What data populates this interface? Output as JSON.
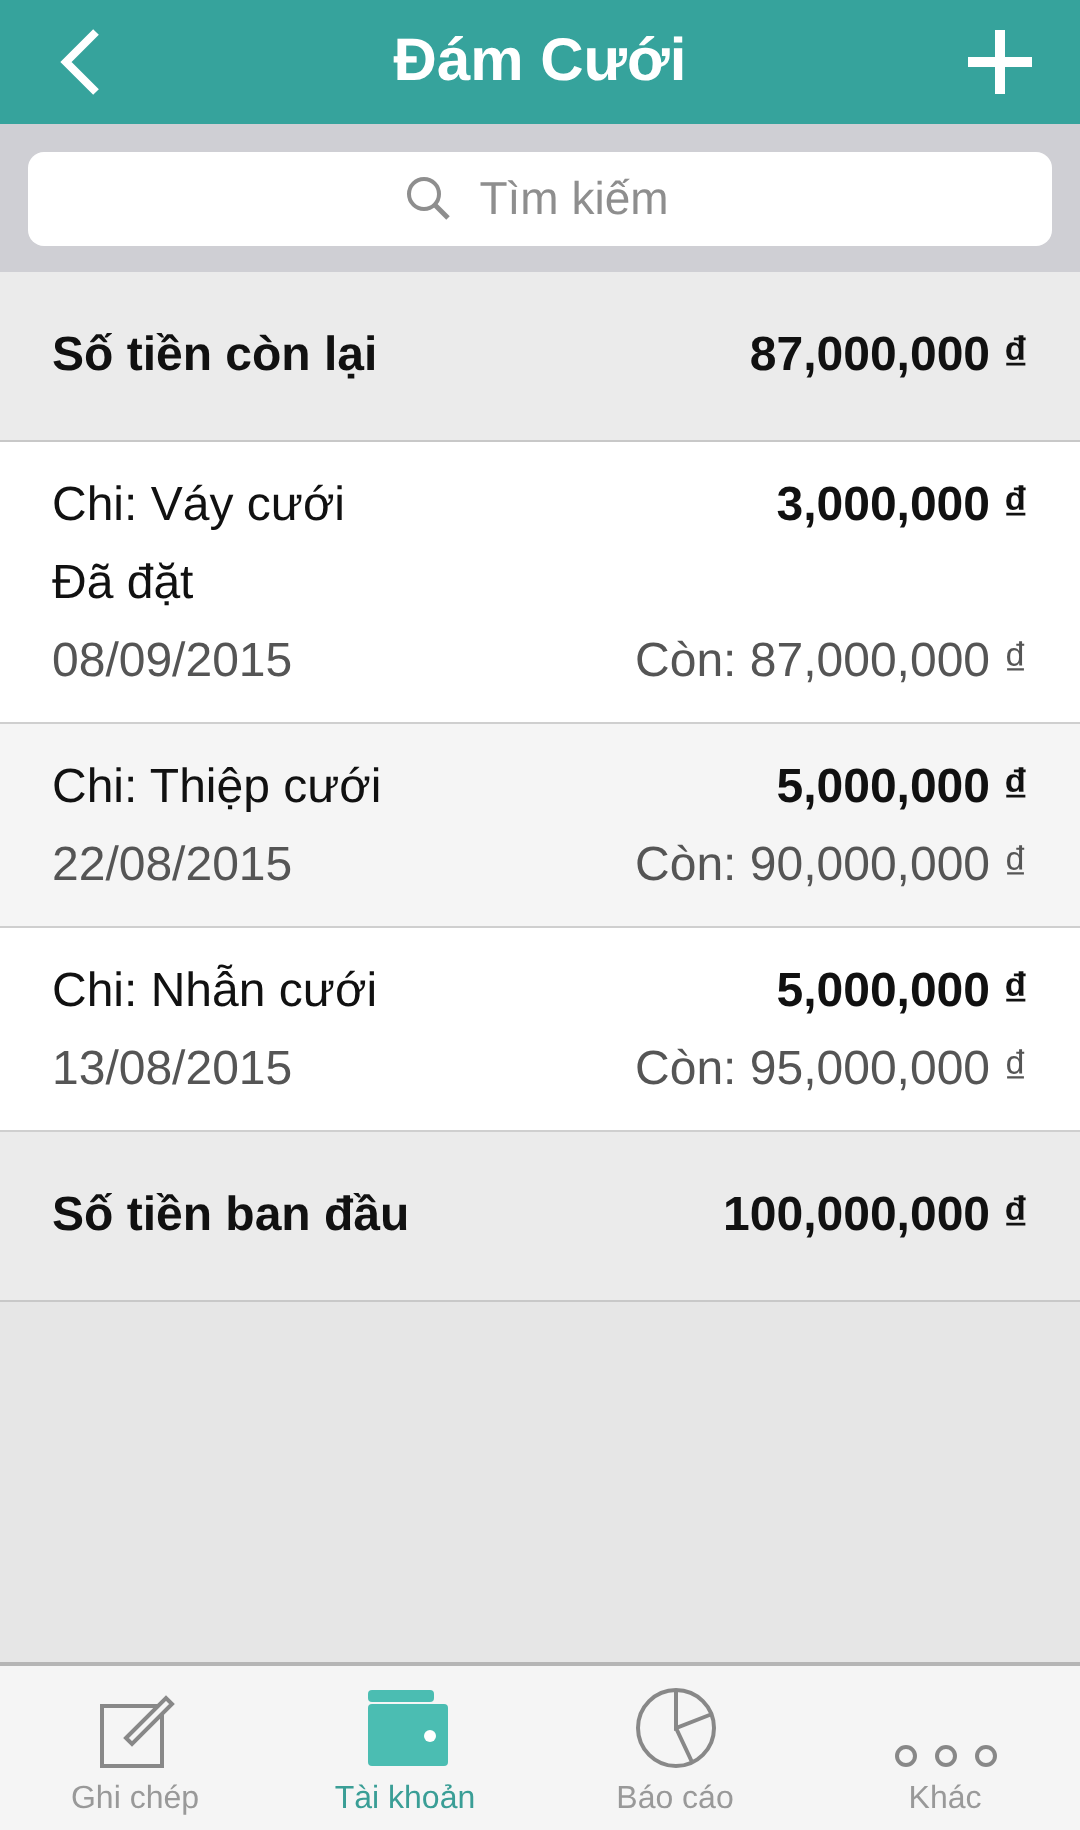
{
  "header": {
    "title": "Đám Cưới"
  },
  "search": {
    "placeholder": "Tìm kiếm"
  },
  "balance": {
    "label": "Số tiền còn lại",
    "amount": "87,000,000 ₫"
  },
  "transactions": [
    {
      "title": "Chi: Váy cưới",
      "note": "Đã đặt",
      "amount": "3,000,000 ₫",
      "date": "08/09/2015",
      "remaining": "Còn: 87,000,000 ₫"
    },
    {
      "title": "Chi: Thiệp cưới",
      "amount": "5,000,000 ₫",
      "date": "22/08/2015",
      "remaining": "Còn: 90,000,000 ₫"
    },
    {
      "title": "Chi: Nhẫn cưới",
      "amount": "5,000,000 ₫",
      "date": "13/08/2015",
      "remaining": "Còn: 95,000,000 ₫"
    }
  ],
  "initial": {
    "label": "Số tiền ban đầu",
    "amount": "100,000,000 ₫"
  },
  "tabs": [
    {
      "label": "Ghi chép",
      "kind": "note",
      "selected": false
    },
    {
      "label": "Tài khoản",
      "kind": "wallet",
      "selected": true
    },
    {
      "label": "Báo cáo",
      "kind": "chart",
      "selected": false
    },
    {
      "label": "Khác",
      "kind": "more",
      "selected": false
    }
  ]
}
